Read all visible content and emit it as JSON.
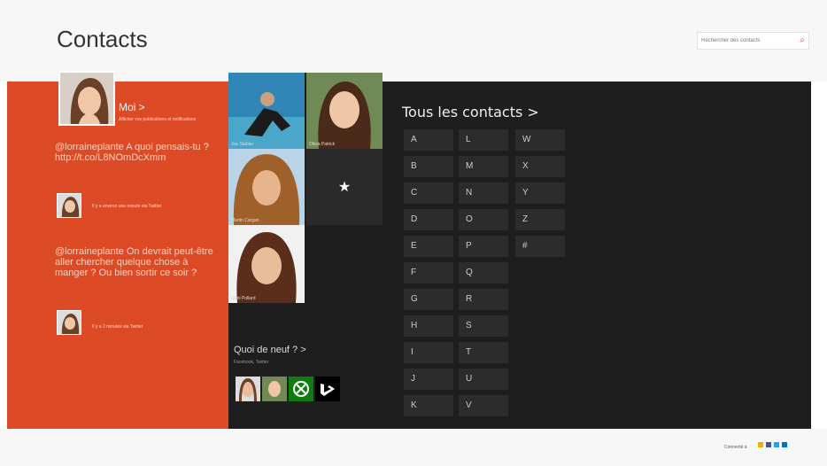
{
  "header": {
    "title": "Contacts",
    "search_placeholder": "Rechercher des contacts"
  },
  "me": {
    "name": "Moi >",
    "subtitle": "Afficher vos publications et notifications",
    "tweets": [
      {
        "text": "@lorraineplante A quoi pensais-tu ? http://t.co/L8NOmDcXmm",
        "meta": "Il y a environ une minute via Twitter"
      },
      {
        "text": "@lorraineplante On devrait peut-être aller chercher quelque chose à manger ? Ou bien sortir ce soir ?",
        "meta": "Il y a 2 minutes via Twitter"
      }
    ]
  },
  "favorites": [
    {
      "name": "Joe Stabler",
      "color": "#2f86b7"
    },
    {
      "name": "Olivia Patrick",
      "color": "#6f8a55"
    },
    {
      "name": "Martin Cargan",
      "color": "#9a5b2e"
    },
    {
      "name": "Mimi Pollard",
      "color": "#8e6d52"
    }
  ],
  "favorite_add_icon": "star-icon",
  "whats_new": {
    "title": "Quoi de neuf ? >",
    "subtitle": "Facebook, Twitter"
  },
  "all_contacts": {
    "title": "Tous les contacts >"
  },
  "letters": [
    "A",
    "B",
    "C",
    "D",
    "E",
    "F",
    "G",
    "H",
    "I",
    "J",
    "K",
    "L",
    "M",
    "N",
    "O",
    "P",
    "Q",
    "R",
    "S",
    "T",
    "U",
    "V",
    "W",
    "X",
    "Y",
    "Z",
    "#"
  ],
  "footer": {
    "connected_label": "Connecté à"
  },
  "colors": {
    "accent": "#dd4b26",
    "panel_dark": "#1e1e1e"
  }
}
